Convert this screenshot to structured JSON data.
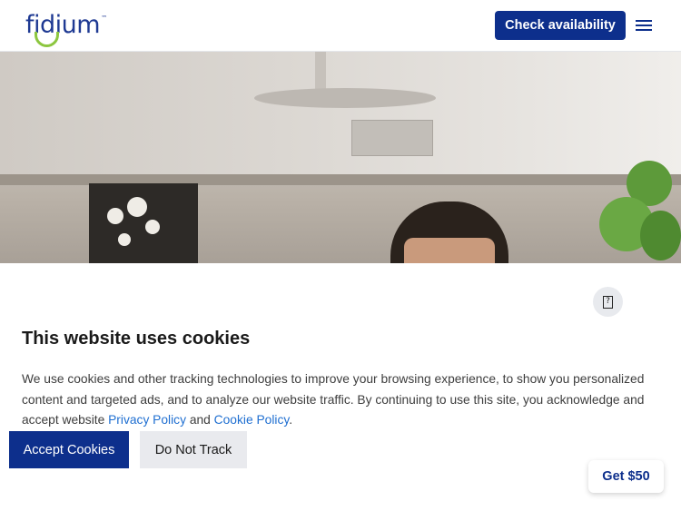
{
  "header": {
    "logo_text": "fidium",
    "logo_tm": "™",
    "check_availability_label": "Check availability",
    "menu_icon": "hamburger-menu-icon"
  },
  "hero": {
    "image_description_icon": "kitchen-photo"
  },
  "help": {
    "icon": "question-box-icon",
    "glyph": "?"
  },
  "cookie_banner": {
    "title": "This website uses cookies",
    "text_before": "We use cookies and other tracking technologies to improve your browsing experience, to show you personalized content and targeted ads, and to analyze our website traffic. By continuing to use this site, you acknowledge and accept website ",
    "privacy_link": "Privacy Policy",
    "text_and": " and ",
    "cookie_link": "Cookie Policy",
    "text_end": ".",
    "accept_label": "Accept Cookies",
    "do_not_track_label": "Do Not Track"
  },
  "promo": {
    "get50_label": "Get $50"
  },
  "colors": {
    "brand_blue": "#0d2f8c",
    "logo_green": "#8cc63f",
    "link_blue": "#1f6fd1"
  }
}
